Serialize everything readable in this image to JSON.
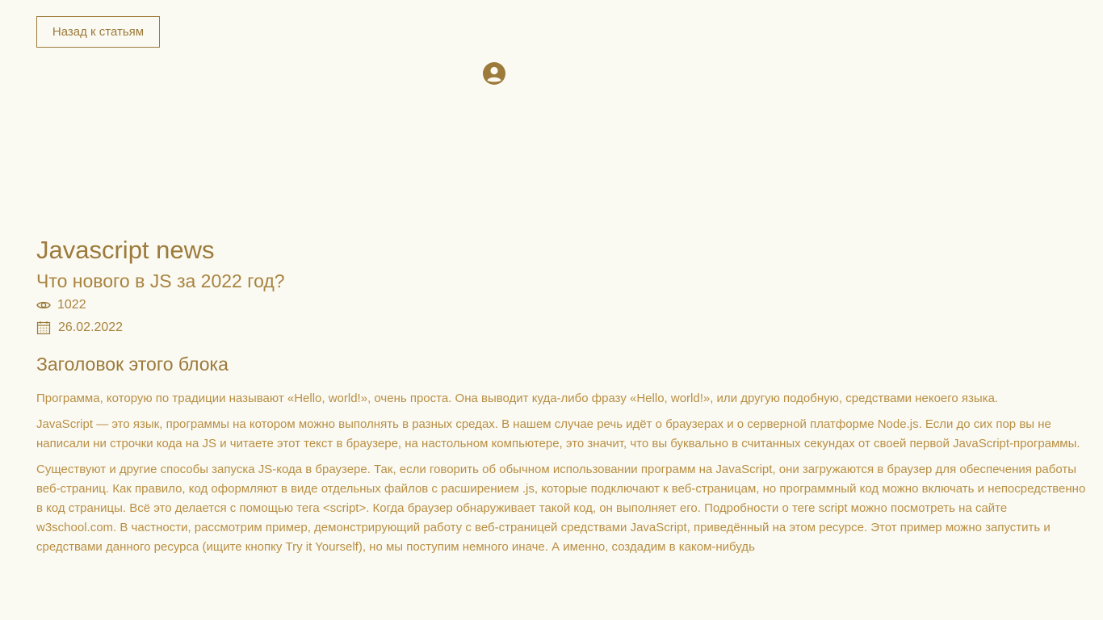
{
  "header": {
    "back_button_label": "Назад к статьям"
  },
  "icons": {
    "avatar": "user-circle-icon",
    "views": "eye-icon",
    "date": "calendar-icon"
  },
  "colors": {
    "background": "#FBFAF2",
    "accent": "#9C7A3B",
    "text": "#B88F45"
  },
  "article": {
    "site_title": "Javascript news",
    "title": "Что нового в JS за 2022 год?",
    "views": "1022",
    "date": "26.02.2022",
    "block_title": "Заголовок этого блока",
    "paragraphs": [
      "Программа, которую по традиции называют «Hello, world!», очень проста. Она выводит куда-либо фразу «Hello, world!», или другую подобную, средствами некоего языка.",
      "JavaScript — это язык, программы на котором можно выполнять в разных средах. В нашем случае речь идёт о браузерах и о серверной платформе Node.js. Если до сих пор вы не написали ни строчки кода на JS и читаете этот текст в браузере, на настольном компьютере, это значит, что вы буквально в считанных секундах от своей первой JavaScript-программы.",
      "Существуют и другие способы запуска JS-кода в браузере. Так, если говорить об обычном использовании программ на JavaScript, они загружаются в браузер для обеспечения работы веб-страниц. Как правило, код оформляют в виде отдельных файлов с расширением .js, которые подключают к веб-страницам, но программный код можно включать и непосредственно в код страницы. Всё это делается с помощью тега <script>. Когда браузер обнаруживает такой код, он выполняет его. Подробности о теге script можно посмотреть на сайте w3school.com. В частности, рассмотрим пример, демонстрирующий работу с веб-страницей средствами JavaScript, приведённый на этом ресурсе. Этот пример можно запустить и средствами данного ресурса (ищите кнопку Try it Yourself), но мы поступим немного иначе. А именно, создадим в каком-нибудь"
    ]
  }
}
